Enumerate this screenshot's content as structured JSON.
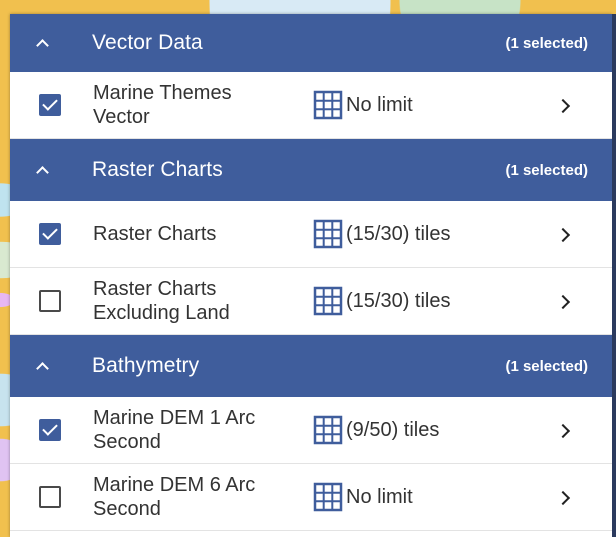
{
  "groups": [
    {
      "title": "Vector Data",
      "count": "(1 selected)",
      "items": [
        {
          "label": "Marine Themes Vector",
          "tiles": "No limit",
          "checked": true
        }
      ]
    },
    {
      "title": "Raster Charts",
      "count": "(1 selected)",
      "items": [
        {
          "label": "Raster Charts",
          "tiles": "(15/30) tiles",
          "checked": true
        },
        {
          "label": "Raster Charts Excluding Land",
          "tiles": "(15/30) tiles",
          "checked": false
        }
      ]
    },
    {
      "title": "Bathymetry",
      "count": "(1 selected)",
      "items": [
        {
          "label": "Marine DEM 1 Arc Second",
          "tiles": "(9/50) tiles",
          "checked": true
        },
        {
          "label": "Marine DEM 6 Arc Second",
          "tiles": "No limit",
          "checked": false
        }
      ]
    }
  ],
  "colors": {
    "header": "#3f5d9c",
    "accent": "#3f5d9c",
    "background": "#f1c04e"
  },
  "icons": {
    "collapse": "chevron-up-icon",
    "tiles": "grid-icon",
    "open": "chevron-right-icon"
  }
}
